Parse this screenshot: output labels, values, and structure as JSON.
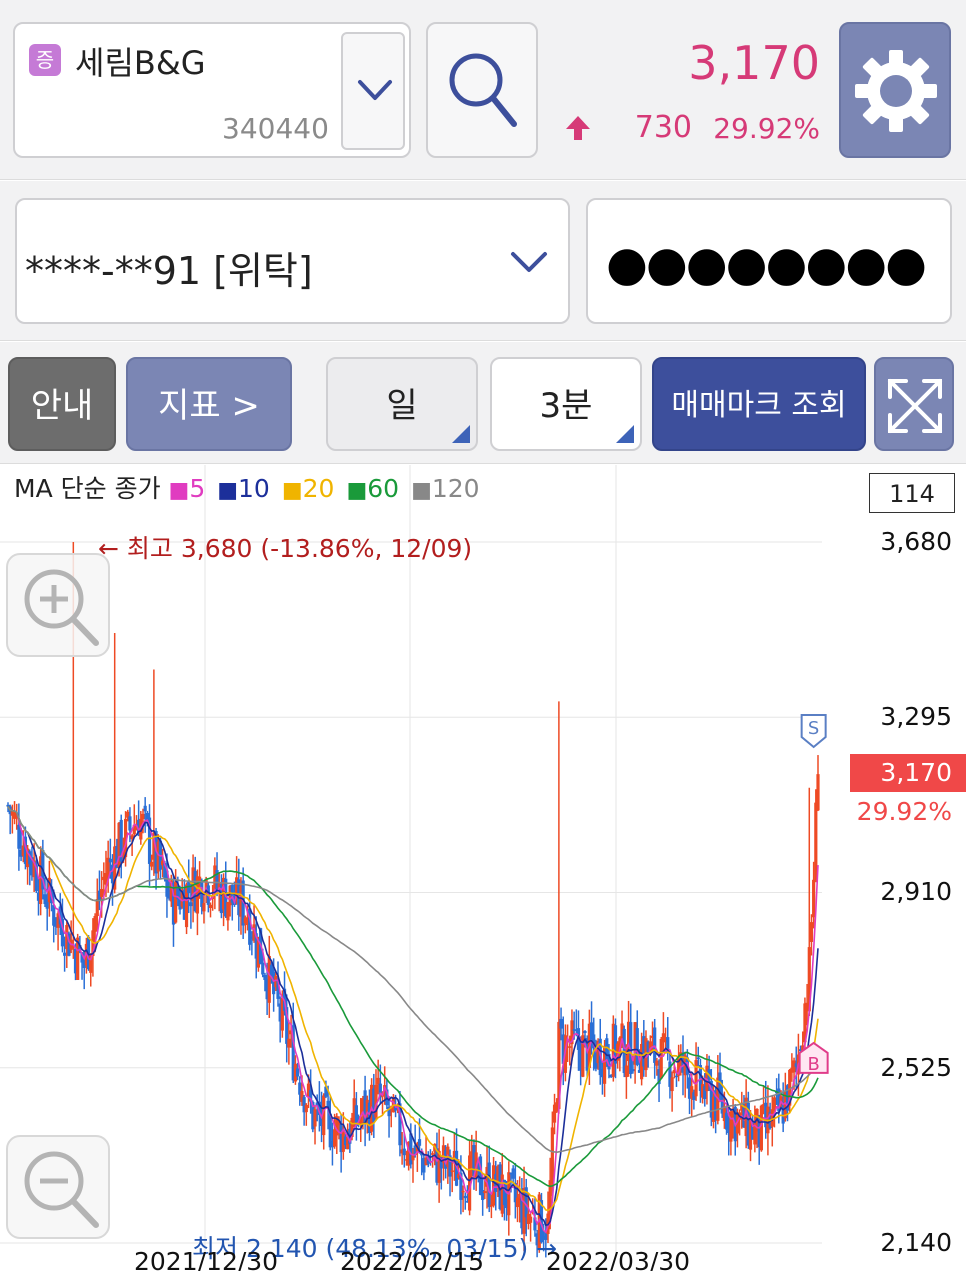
{
  "stock": {
    "badge": "증",
    "name": "세림B&G",
    "code": "340440",
    "price": "3,170",
    "change": "730",
    "change_rate": "29.92%"
  },
  "account": {
    "number": "****-**91 [위탁]",
    "password_mask": "●●●●●●●●"
  },
  "toolbar": {
    "guide_label": "안내",
    "indicator_label": "지표 >",
    "period_label": "일",
    "interval_label": "3분",
    "trade_mark_label": "매매마크 조회"
  },
  "legend": {
    "title": "MA 단순 종가",
    "ma": [
      {
        "label": "5",
        "color": "#e03cc0"
      },
      {
        "label": "10",
        "color": "#1c2f9a"
      },
      {
        "label": "20",
        "color": "#f0b400"
      },
      {
        "label": "60",
        "color": "#1a9a3a"
      },
      {
        "label": "120",
        "color": "#888888"
      }
    ]
  },
  "chart": {
    "volume_box": "114",
    "y_labels": [
      "3,680",
      "3,295",
      "2,910",
      "2,525",
      "2,140"
    ],
    "current_price_tag": "3,170",
    "current_rate_tag": "29.92%",
    "high_annotation": "← 최고 3,680 (-13.86%, 12/09)",
    "low_annotation": "최저 2,140 (48.13%, 03/15) →",
    "x_labels": [
      "2021/12/30",
      "2022/02/15",
      "2022/03/30"
    ],
    "marker_sell": "S",
    "marker_buy": "B",
    "colors": {
      "up": "#ee4a24",
      "down": "#2a6fd6",
      "grid": "#e6e6e6"
    }
  },
  "chart_data": {
    "type": "candlestick",
    "ylim": [
      2140,
      3680
    ],
    "yticks": [
      3680,
      3295,
      2910,
      2525,
      2140
    ],
    "xlabels": [
      "2021/12/30",
      "2022/02/15",
      "2022/03/30"
    ],
    "high": {
      "value": 3680,
      "rate": "-13.86%",
      "date": "12/09"
    },
    "low": {
      "value": 2140,
      "rate": "48.13%",
      "date": "03/15"
    },
    "last": {
      "value": 3170,
      "rate": "29.92%"
    },
    "ma_periods": [
      5,
      10,
      20,
      60,
      120
    ]
  }
}
